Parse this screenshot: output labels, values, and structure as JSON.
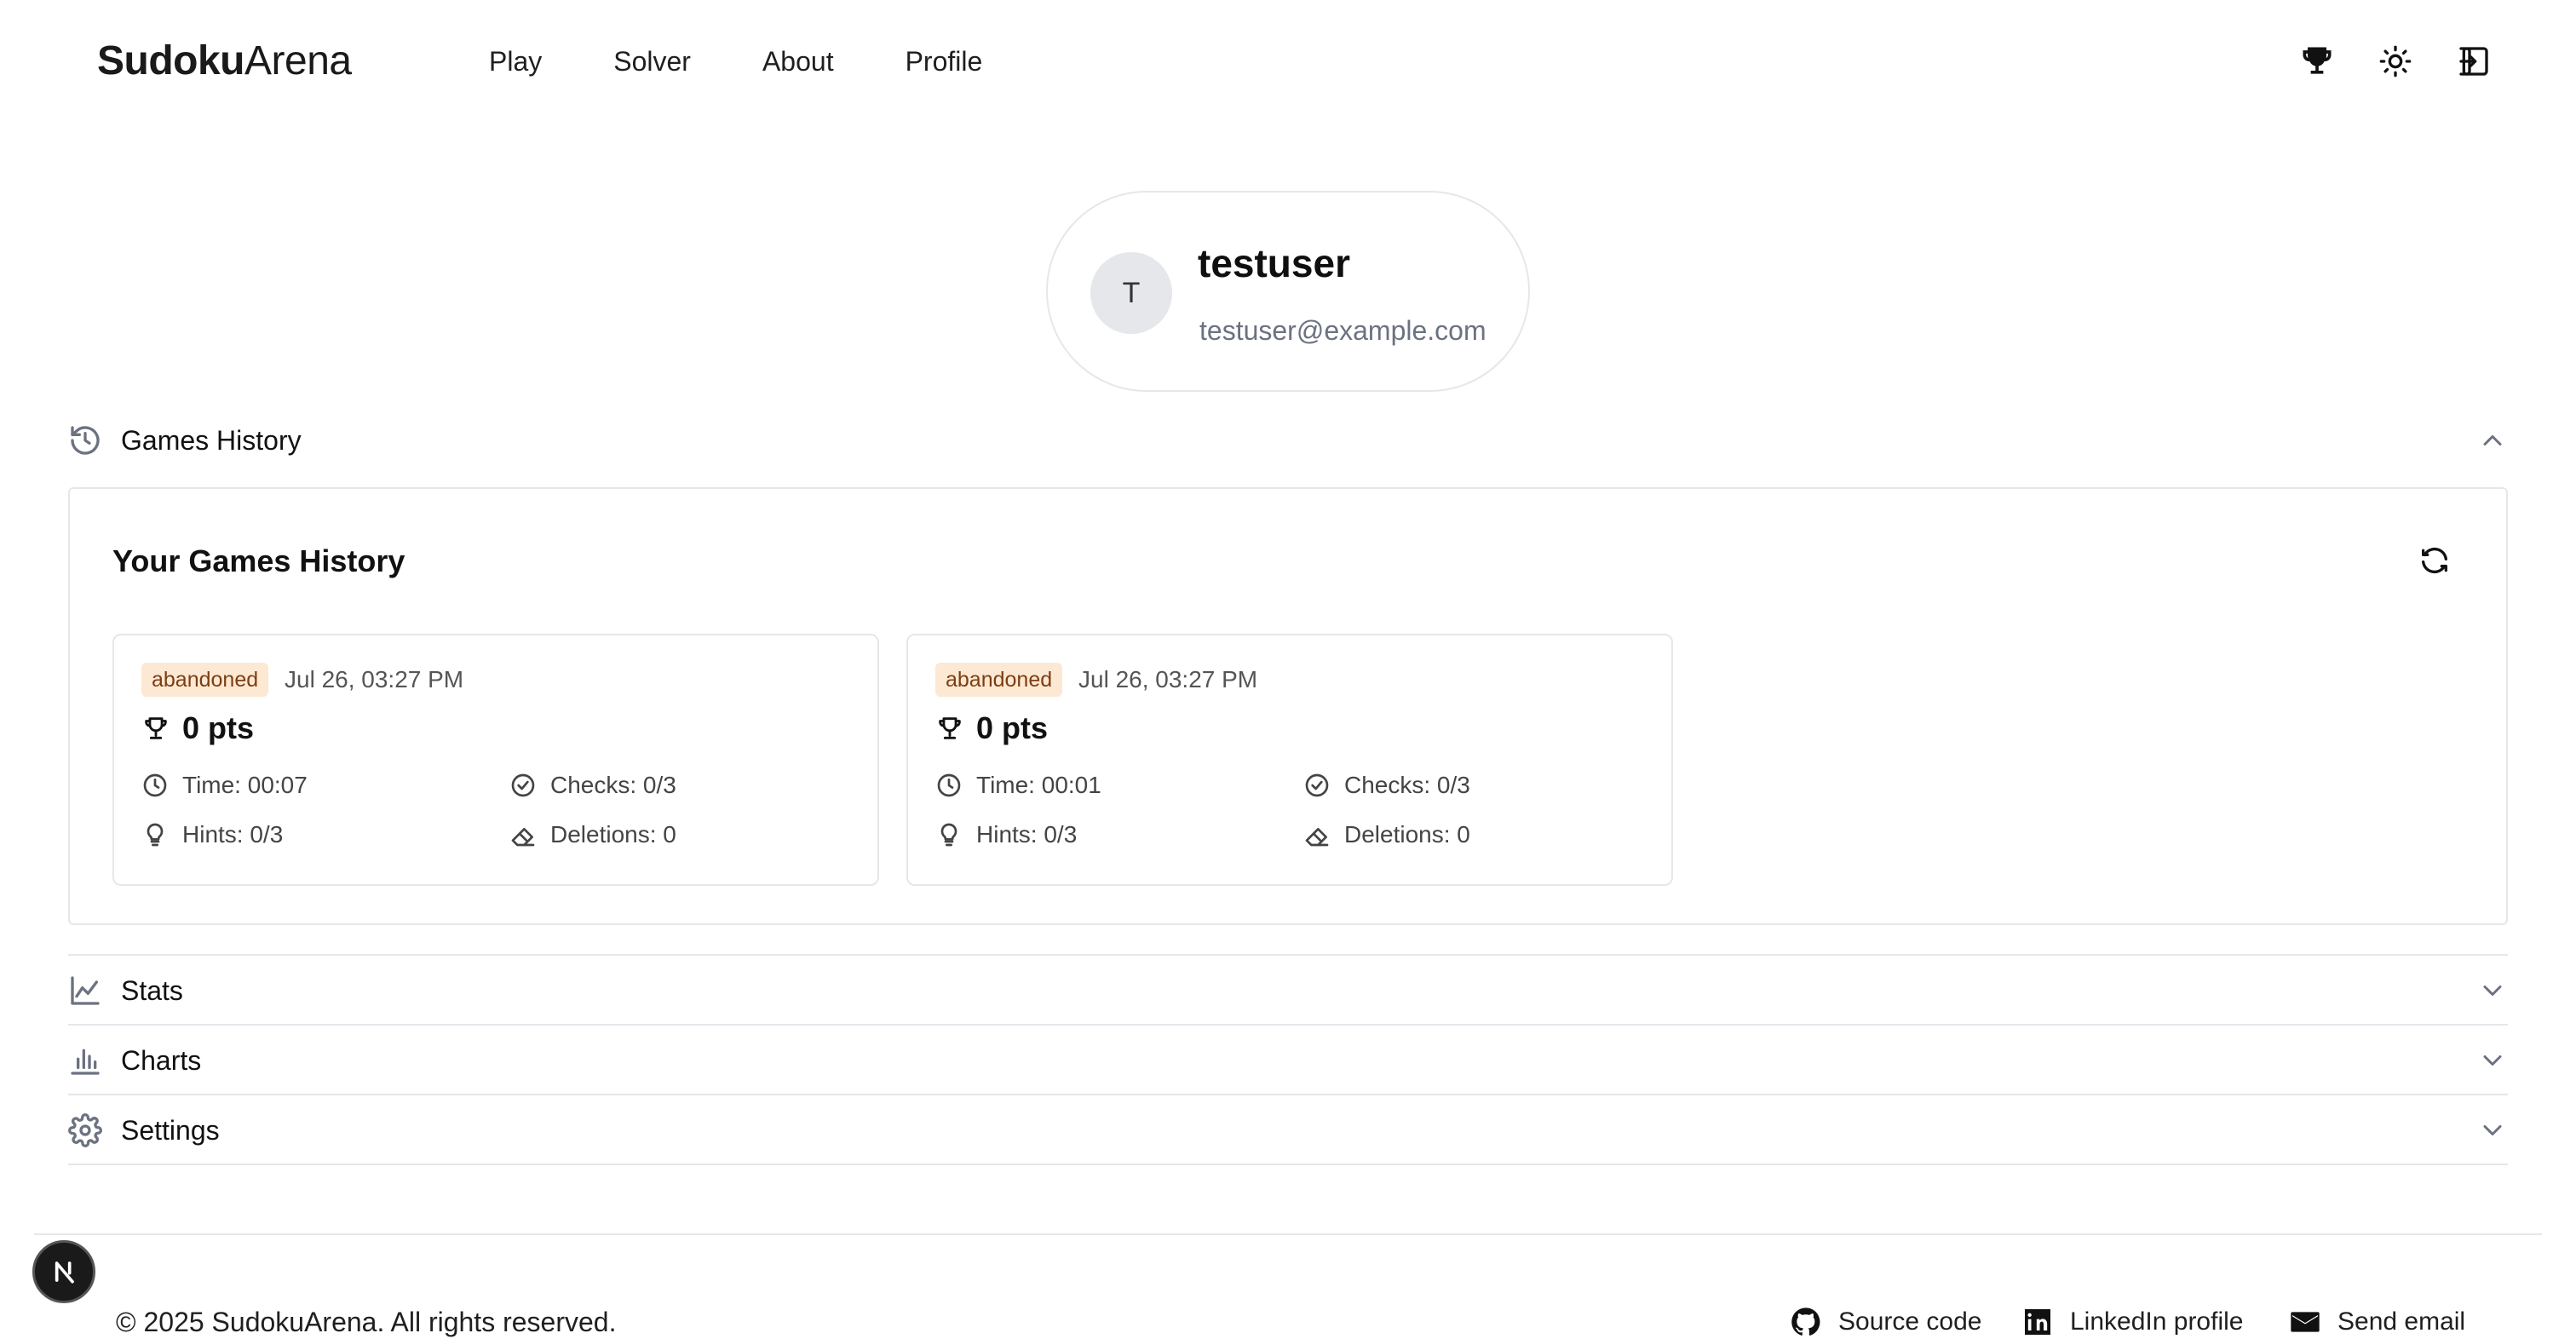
{
  "brand": {
    "strong": "Sudoku",
    "light": "Arena"
  },
  "nav": {
    "links": [
      "Play",
      "Solver",
      "About",
      "Profile"
    ]
  },
  "header_icons": [
    "trophy-icon",
    "sun-icon",
    "logout-icon"
  ],
  "profile": {
    "initial": "T",
    "username": "testuser",
    "email": "testuser@example.com"
  },
  "sections": {
    "history": {
      "label": "Games History",
      "icon": "history-icon",
      "expanded": true
    },
    "stats": {
      "label": "Stats",
      "icon": "line-chart-icon",
      "expanded": false
    },
    "charts": {
      "label": "Charts",
      "icon": "bar-chart-icon",
      "expanded": false
    },
    "settings": {
      "label": "Settings",
      "icon": "gear-icon",
      "expanded": false
    }
  },
  "history": {
    "title": "Your Games History",
    "games": [
      {
        "status": "abandoned",
        "date": "Jul 26, 03:27 PM",
        "points": "0 pts",
        "time": "Time: 00:07",
        "checks": "Checks: 0/3",
        "hints": "Hints: 0/3",
        "deletions": "Deletions: 0"
      },
      {
        "status": "abandoned",
        "date": "Jul 26, 03:27 PM",
        "points": "0 pts",
        "time": "Time: 00:01",
        "checks": "Checks: 0/3",
        "hints": "Hints: 0/3",
        "deletions": "Deletions: 0"
      }
    ]
  },
  "footer": {
    "copyright": "© 2025 SudokuArena. All rights reserved.",
    "links": [
      {
        "label": "Source code",
        "icon": "github-icon"
      },
      {
        "label": "LinkedIn profile",
        "icon": "linkedin-icon"
      },
      {
        "label": "Send email",
        "icon": "mail-icon"
      }
    ],
    "dev_badge": "N"
  },
  "colors": {
    "badge_bg": "#fde8d3",
    "badge_text": "#7c3e12",
    "border": "#e5e7eb",
    "muted": "#6b7280"
  }
}
